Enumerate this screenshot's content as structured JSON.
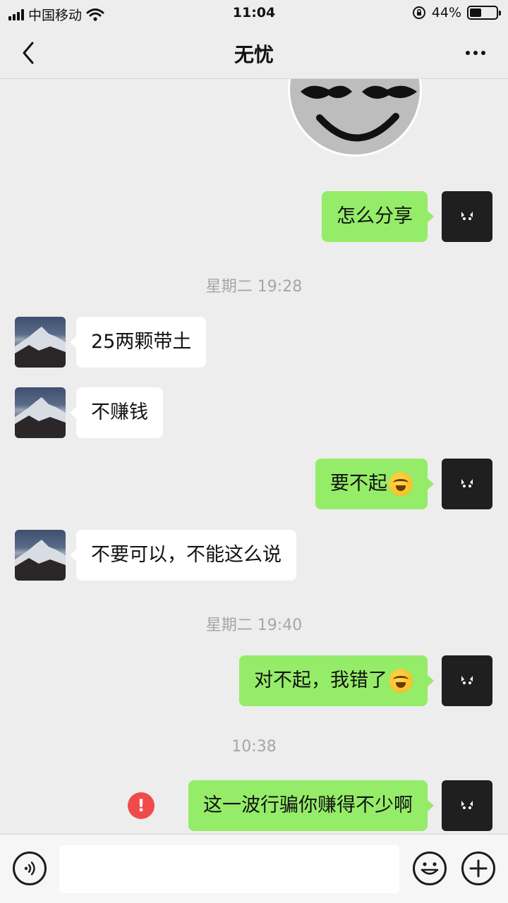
{
  "status_bar": {
    "carrier": "中国移动",
    "time": "11:04",
    "battery_percent": "44%",
    "battery_level": 0.44
  },
  "nav": {
    "title": "无忧"
  },
  "messages": [
    {
      "id": "m1",
      "side": "me",
      "text": "怎么分享"
    },
    {
      "id": "t1",
      "type": "time",
      "text": "星期二 19:28"
    },
    {
      "id": "m2",
      "side": "them",
      "text": "25两颗带土"
    },
    {
      "id": "m3",
      "side": "them",
      "text": "不赚钱"
    },
    {
      "id": "m4",
      "side": "me",
      "text": "要不起",
      "emoji": "facepalm-laugh-emoji"
    },
    {
      "id": "m5",
      "side": "them",
      "text": "不要可以，不能这么说"
    },
    {
      "id": "t2",
      "type": "time",
      "text": "星期二 19:40"
    },
    {
      "id": "m6",
      "side": "me",
      "text": "对不起，我错了",
      "emoji": "facepalm-laugh-emoji"
    },
    {
      "id": "t3",
      "type": "time",
      "text": "10:38"
    },
    {
      "id": "m7",
      "side": "me",
      "text": "这一波行骗你赚得不少啊",
      "status": "failed",
      "status_icon": "!"
    }
  ],
  "input_bar": {
    "placeholder": "",
    "icons": [
      "voice-icon",
      "emoji-icon",
      "plus-icon"
    ]
  },
  "colors": {
    "background": "#ededed",
    "my_bubble": "#95ec69",
    "their_bubble": "#ffffff",
    "error": "#f04b4b"
  }
}
